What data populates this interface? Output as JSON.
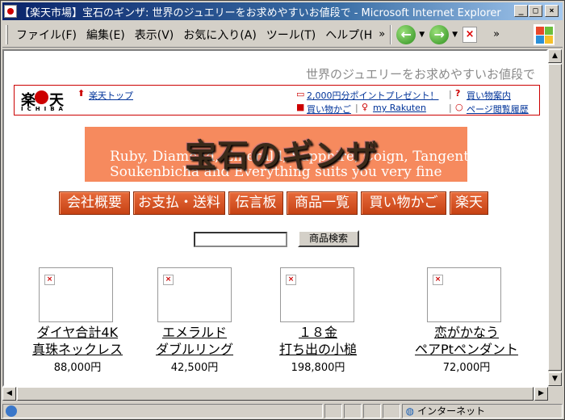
{
  "window": {
    "title": "【楽天市場】宝石のギンザ: 世界のジュエリーをお求めやすいお値段で - Microsoft Internet Explorer",
    "controls": [
      "_",
      "□",
      "×"
    ]
  },
  "menu": {
    "items": [
      "ファイル(F)",
      "編集(E)",
      "表示(V)",
      "お気に入り(A)",
      "ツール(T)",
      "ヘルプ(H"
    ],
    "more": "»"
  },
  "toolbar": {
    "back": "←",
    "forward": "→",
    "stop": "×",
    "more": "»"
  },
  "page": {
    "tagline": "世界のジュエリーをお求めやすいお値段で",
    "rakuten": {
      "logo_kanji_left": "楽",
      "logo_kanji_right": "天",
      "logo_sub": "ICHIBA",
      "top_link": "楽天トップ",
      "points_link": "2,000円分ポイントプレゼント！",
      "cart_link": "買い物かご",
      "myr_link": "my Rakuten",
      "guide_link": "買い物案内",
      "history_link": "ページ閲覧履歴"
    },
    "banner": {
      "title": "宝石のギンザ",
      "subtitle_line1": "Ruby, Diamond, Emerald, Sapphire, Coign, Tangent,",
      "subtitle_line2": "Soukenbicha and Everything suits you very fine"
    },
    "nav": [
      "会社概要",
      "お支払・送料",
      "伝言板",
      "商品一覧",
      "買い物かご",
      "楽天"
    ],
    "search": {
      "value": "",
      "button": "商品検索"
    },
    "products": [
      {
        "name1": "ダイヤ合計4K",
        "name2": "真珠ネックレス",
        "price": "88,000円"
      },
      {
        "name1": "エメラルド",
        "name2": "ダブルリング",
        "price": "42,500円"
      },
      {
        "name1": "１８金",
        "name2": "打ち出の小槌",
        "price": "198,800円"
      },
      {
        "name1": "恋がかなう",
        "name2": "ペアPtペンダント",
        "price": "72,000円"
      }
    ]
  },
  "status": {
    "zone": "インターネット"
  }
}
